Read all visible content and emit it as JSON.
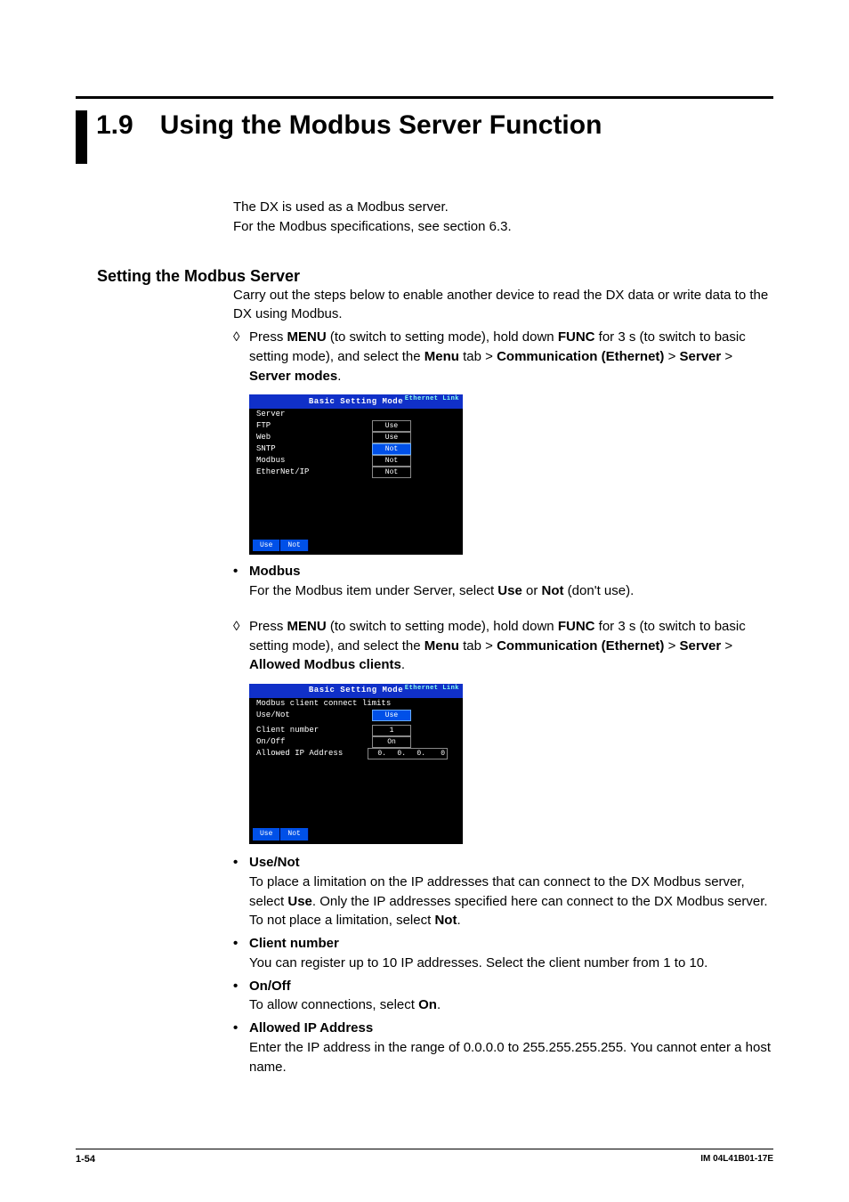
{
  "section": {
    "number": "1.9",
    "title": "Using the Modbus Server Function"
  },
  "intro": {
    "l1": "The DX is used as a Modbus server.",
    "l2": "For the Modbus specifications, see section 6.3."
  },
  "h2": "Setting the Modbus Server",
  "h2p": "Carry out the steps below to enable another device to read the DX data or write data to the DX using Modbus.",
  "step1": {
    "sym": "◊",
    "p1a": "Press ",
    "p1b": "MENU",
    "p1c": " (to switch to setting mode), hold down ",
    "p1d": "FUNC",
    "p1e": " for 3 s (to switch to basic setting mode), and select the ",
    "p1f": "Menu",
    "p1g": " tab > ",
    "p1h": "Communication (Ethernet)",
    "p1i": " > ",
    "p1j": "Server",
    "p1k": " > ",
    "p1l": "Server modes",
    "p1m": "."
  },
  "screen1": {
    "title": "Basic Setting Mode",
    "eth": "Ethernet\nLink",
    "grp": "Server",
    "rows": [
      {
        "label": "FTP",
        "val": "Use",
        "sel": false
      },
      {
        "label": "Web",
        "val": "Use",
        "sel": false
      },
      {
        "label": "SNTP",
        "val": "Not",
        "sel": true
      },
      {
        "label": "Modbus",
        "val": "Not",
        "sel": false
      },
      {
        "label": "EtherNet/IP",
        "val": "Not",
        "sel": false
      }
    ],
    "btns": [
      "Use",
      "Not"
    ]
  },
  "modbus": {
    "h": "Modbus",
    "p1": "For the Modbus item under Server, select ",
    "p2": "Use",
    "p3": " or ",
    "p4": "Not",
    "p5": " (don't use)."
  },
  "step2": {
    "sym": "◊",
    "p1a": "Press ",
    "p1b": "MENU",
    "p1c": " (to switch to setting mode), hold down ",
    "p1d": "FUNC",
    "p1e": " for 3 s (to switch to basic setting mode), and select the ",
    "p1f": "Menu",
    "p1g": " tab > ",
    "p1h": "Communication (Ethernet)",
    "p1i": " > ",
    "p1j": "Server",
    "p1k": " > ",
    "p1l": "Allowed Modbus clients",
    "p1m": "."
  },
  "screen2": {
    "title": "Basic Setting Mode",
    "eth": "Ethernet\nLink",
    "grp": "Modbus client connect limits",
    "rows": [
      {
        "label": "Use/Not",
        "val": "Use",
        "sel": true
      }
    ],
    "rows2": [
      {
        "label": "Client number",
        "val": "1",
        "sel": false
      },
      {
        "label": "On/Off",
        "val": "On",
        "sel": false
      }
    ],
    "ip": {
      "label": "Allowed IP Address",
      "segs": [
        "0.",
        "0.",
        "0.",
        "0"
      ]
    },
    "btns": [
      "Use",
      "Not"
    ]
  },
  "usenot": {
    "h": "Use/Not",
    "p1": "To place a limitation on the IP addresses that can connect to the DX Modbus server, select ",
    "p2": "Use",
    "p3": ". Only the IP addresses specified here can connect to the DX Modbus server. To not place a limitation, select ",
    "p4": "Not",
    "p5": "."
  },
  "clientnum": {
    "h": "Client number",
    "p": "You can register up to 10 IP addresses. Select the client number from 1 to 10."
  },
  "onoff": {
    "h": "On/Off",
    "p1": "To allow connections, select ",
    "p2": "On",
    "p3": "."
  },
  "allowedip": {
    "h": "Allowed IP Address",
    "p": "Enter the IP address in the range of 0.0.0.0 to 255.255.255.255. You cannot enter a host name."
  },
  "footer": {
    "left": "1-54",
    "right": "IM 04L41B01-17E"
  },
  "bullet": "•"
}
